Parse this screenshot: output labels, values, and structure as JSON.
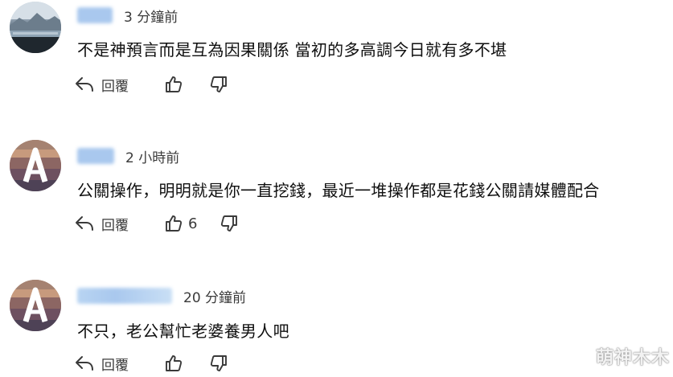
{
  "comments": [
    {
      "avatar": "landscape-photo-avatar",
      "timestamp": "3 分鐘前",
      "text": "不是神預言而是互為因果關係 當初的多高調今日就有多不堪",
      "reply_label": "回覆",
      "like_count": ""
    },
    {
      "avatar": "letter-a-avatar",
      "timestamp": "2 小時前",
      "text": "公關操作，明明就是你一直挖錢，最近一堆操作都是花錢公關請媒體配合",
      "reply_label": "回覆",
      "like_count": "6"
    },
    {
      "avatar": "letter-a-avatar",
      "timestamp": "20 分鐘前",
      "text": "不只，老公幫忙老婆養男人吧",
      "reply_label": "回覆",
      "like_count": ""
    }
  ],
  "icons": {
    "reply": "reply-arrow-icon",
    "like": "thumbs-up-icon",
    "dislike": "thumbs-down-icon"
  },
  "colors": {
    "text": "#0f0f0f",
    "muted": "#3a3a3a",
    "name_blur": "#a9c8ee"
  },
  "watermark": "萌神木木"
}
